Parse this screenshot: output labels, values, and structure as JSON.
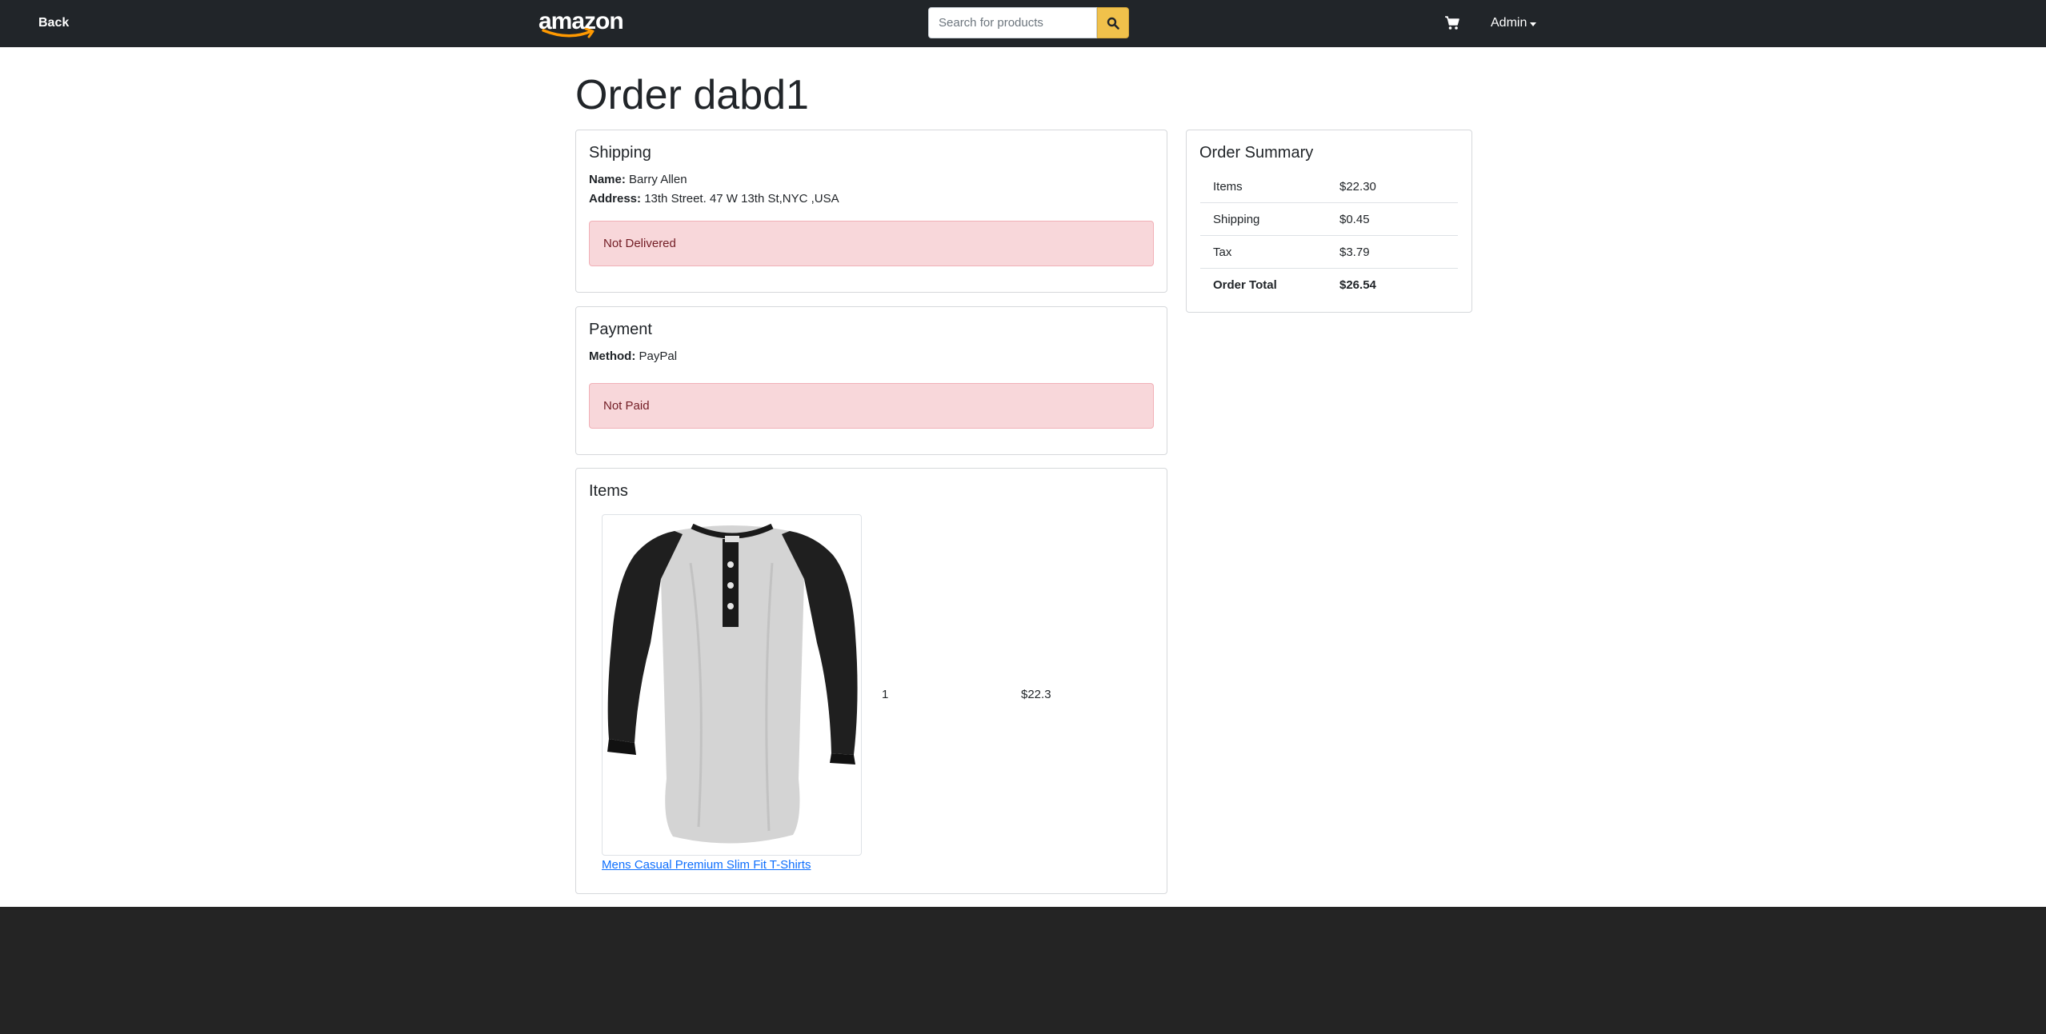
{
  "nav": {
    "back_label": "Back",
    "logo_text": "amazon",
    "search_placeholder": "Search for products",
    "search_icon": "search-icon",
    "cart_icon": "cart-icon",
    "admin_label": "Admin"
  },
  "page": {
    "title": "Order dabd1"
  },
  "shipping": {
    "title": "Shipping",
    "name_label": "Name:",
    "name_value": "Barry Allen",
    "address_label": "Address:",
    "address_value": "13th Street. 47 W 13th St,NYC ,USA",
    "status": "Not Delivered"
  },
  "payment": {
    "title": "Payment",
    "method_label": "Method:",
    "method_value": "PayPal",
    "status": "Not Paid"
  },
  "items": {
    "title": "Items",
    "list": [
      {
        "name": "Mens Casual Premium Slim Fit T-Shirts",
        "quantity": "1",
        "price": "$22.3"
      }
    ]
  },
  "summary": {
    "title": "Order Summary",
    "rows": [
      {
        "label": "Items",
        "value": "$22.30"
      },
      {
        "label": "Shipping",
        "value": "$0.45"
      },
      {
        "label": "Tax",
        "value": "$3.79"
      },
      {
        "label": "Order Total",
        "value": "$26.54"
      }
    ]
  },
  "colors": {
    "navbar": "#212529",
    "search_button": "#f0c14b",
    "alert_bg": "#f8d7da",
    "link": "#0d6efd",
    "footer": "#242424"
  }
}
